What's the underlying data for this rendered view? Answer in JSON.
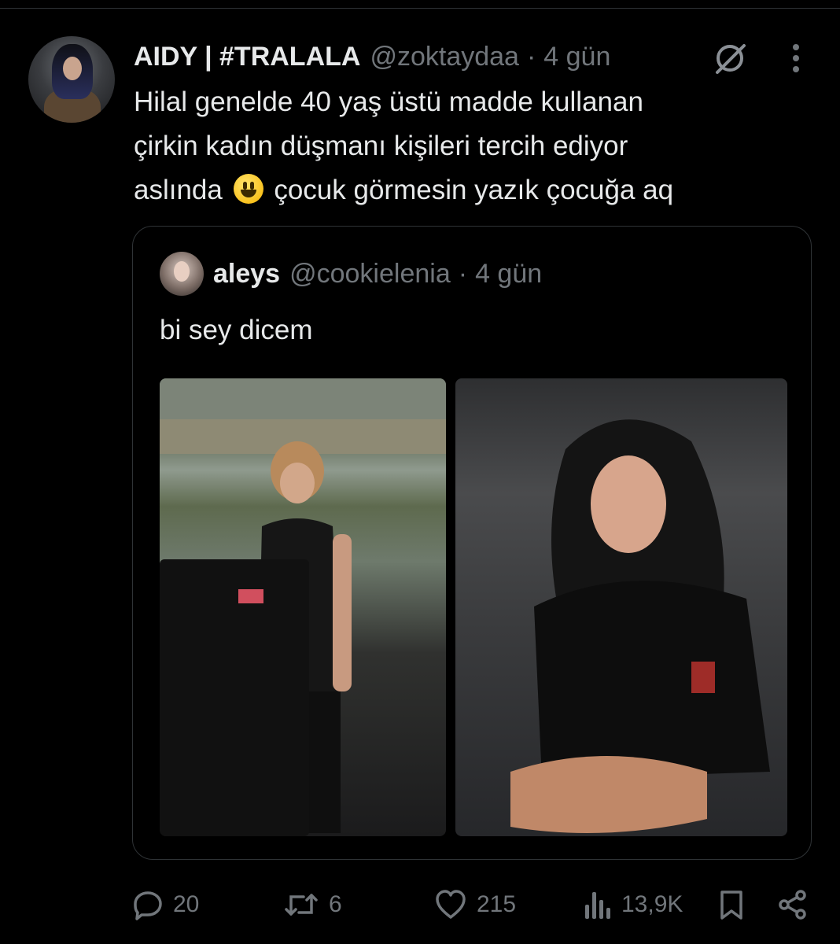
{
  "tweet": {
    "display_name": "AIDY | #TRALALA",
    "handle": "@zoktaydaa",
    "separator": "·",
    "time": "4 gün",
    "text_line1": "Hilal genelde 40 yaş üstü madde kullanan",
    "text_line2": "çirkin kadın düşmanı kişileri tercih ediyor",
    "text_line3_before_emoji": "aslında",
    "text_line3_after_emoji": "çocuk görmesin yazık çocuğa aq",
    "emoji": "smiling-face"
  },
  "quoted": {
    "display_name": "aleys",
    "handle": "@cookielenia",
    "separator": "·",
    "time": "4 gün",
    "text": "bi sey dicem",
    "images": [
      "photo-film-set",
      "photo-woman-black-tshirt"
    ]
  },
  "actions": {
    "replies": "20",
    "reposts": "6",
    "likes": "215",
    "views": "13,9K"
  },
  "icons": {
    "grok": "grok-icon",
    "more": "more-icon",
    "reply": "reply-icon",
    "repost": "repost-icon",
    "like": "like-icon",
    "views": "views-icon",
    "bookmark": "bookmark-icon",
    "share": "share-icon"
  },
  "colors": {
    "background": "#000000",
    "text": "#e7e9ea",
    "muted": "#71767b",
    "border": "#2f3336"
  }
}
